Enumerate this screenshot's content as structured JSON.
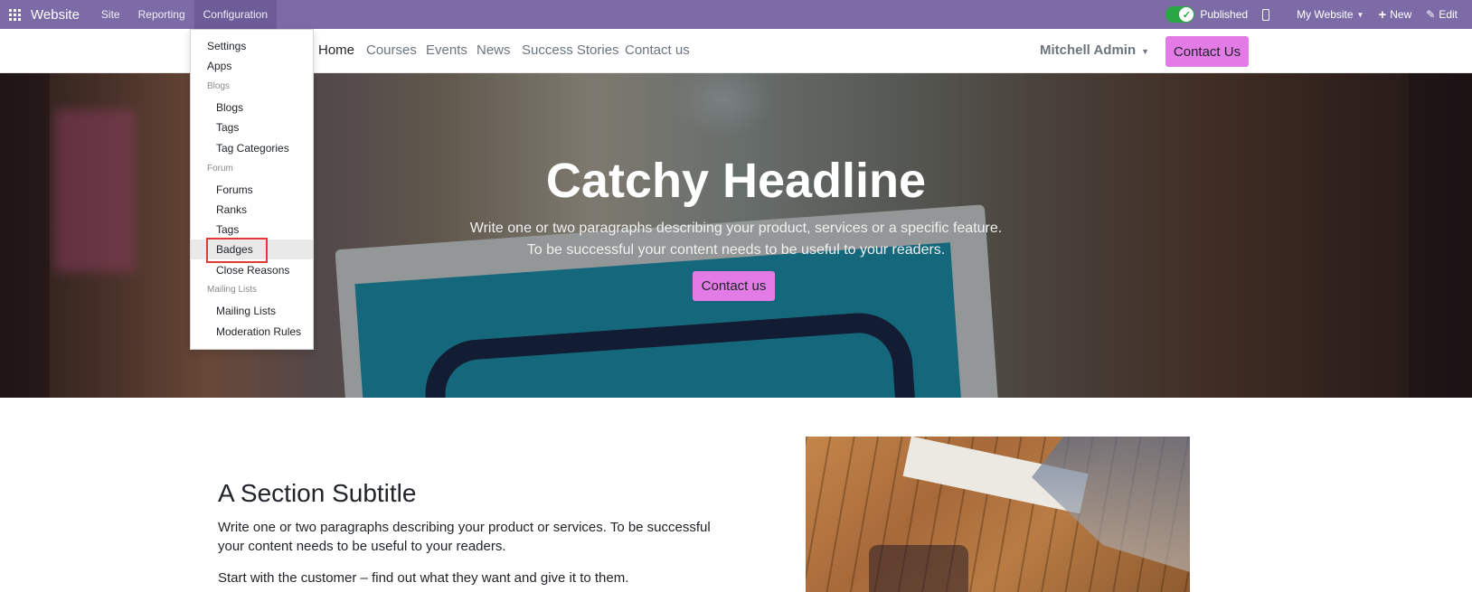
{
  "admin_bar": {
    "brand": "Website",
    "menus": [
      "Site",
      "Reporting",
      "Configuration"
    ],
    "published_label": "Published",
    "website_selector": "My Website",
    "new_label": "New",
    "edit_label": "Edit",
    "colors": {
      "bar": "#7c6ba6",
      "toggle_on": "#28a745"
    }
  },
  "site_nav": {
    "links": [
      "Home",
      "Courses",
      "Events",
      "News",
      "Success Stories",
      "Contact us"
    ],
    "current": "Home",
    "user": "Mitchell Admin",
    "cta": "Contact Us",
    "colors": {
      "cta": "#e37be7"
    }
  },
  "dropdown": {
    "settings": "Settings",
    "apps": "Apps",
    "blogs_header": "Blogs",
    "blogs_items": [
      "Blogs",
      "Tags",
      "Tag Categories"
    ],
    "forum_header": "Forum",
    "forum_items": [
      "Forums",
      "Ranks",
      "Tags",
      "Badges",
      "Close Reasons"
    ],
    "mailing_header": "Mailing Lists",
    "mailing_items": [
      "Mailing Lists",
      "Moderation Rules"
    ],
    "highlighted": "Badges"
  },
  "hero": {
    "title": "Catchy Headline",
    "line1": "Write one or two paragraphs describing your product, services or a specific feature.",
    "line2": "To be successful your content needs to be useful to your readers.",
    "button": "Contact us"
  },
  "section": {
    "subtitle": "A Section Subtitle",
    "paragraph1": "Write one or two paragraphs describing your product or services. To be successful your content needs to be useful to your readers.",
    "paragraph2": "Start with the customer – find out what they want and give it to them."
  }
}
